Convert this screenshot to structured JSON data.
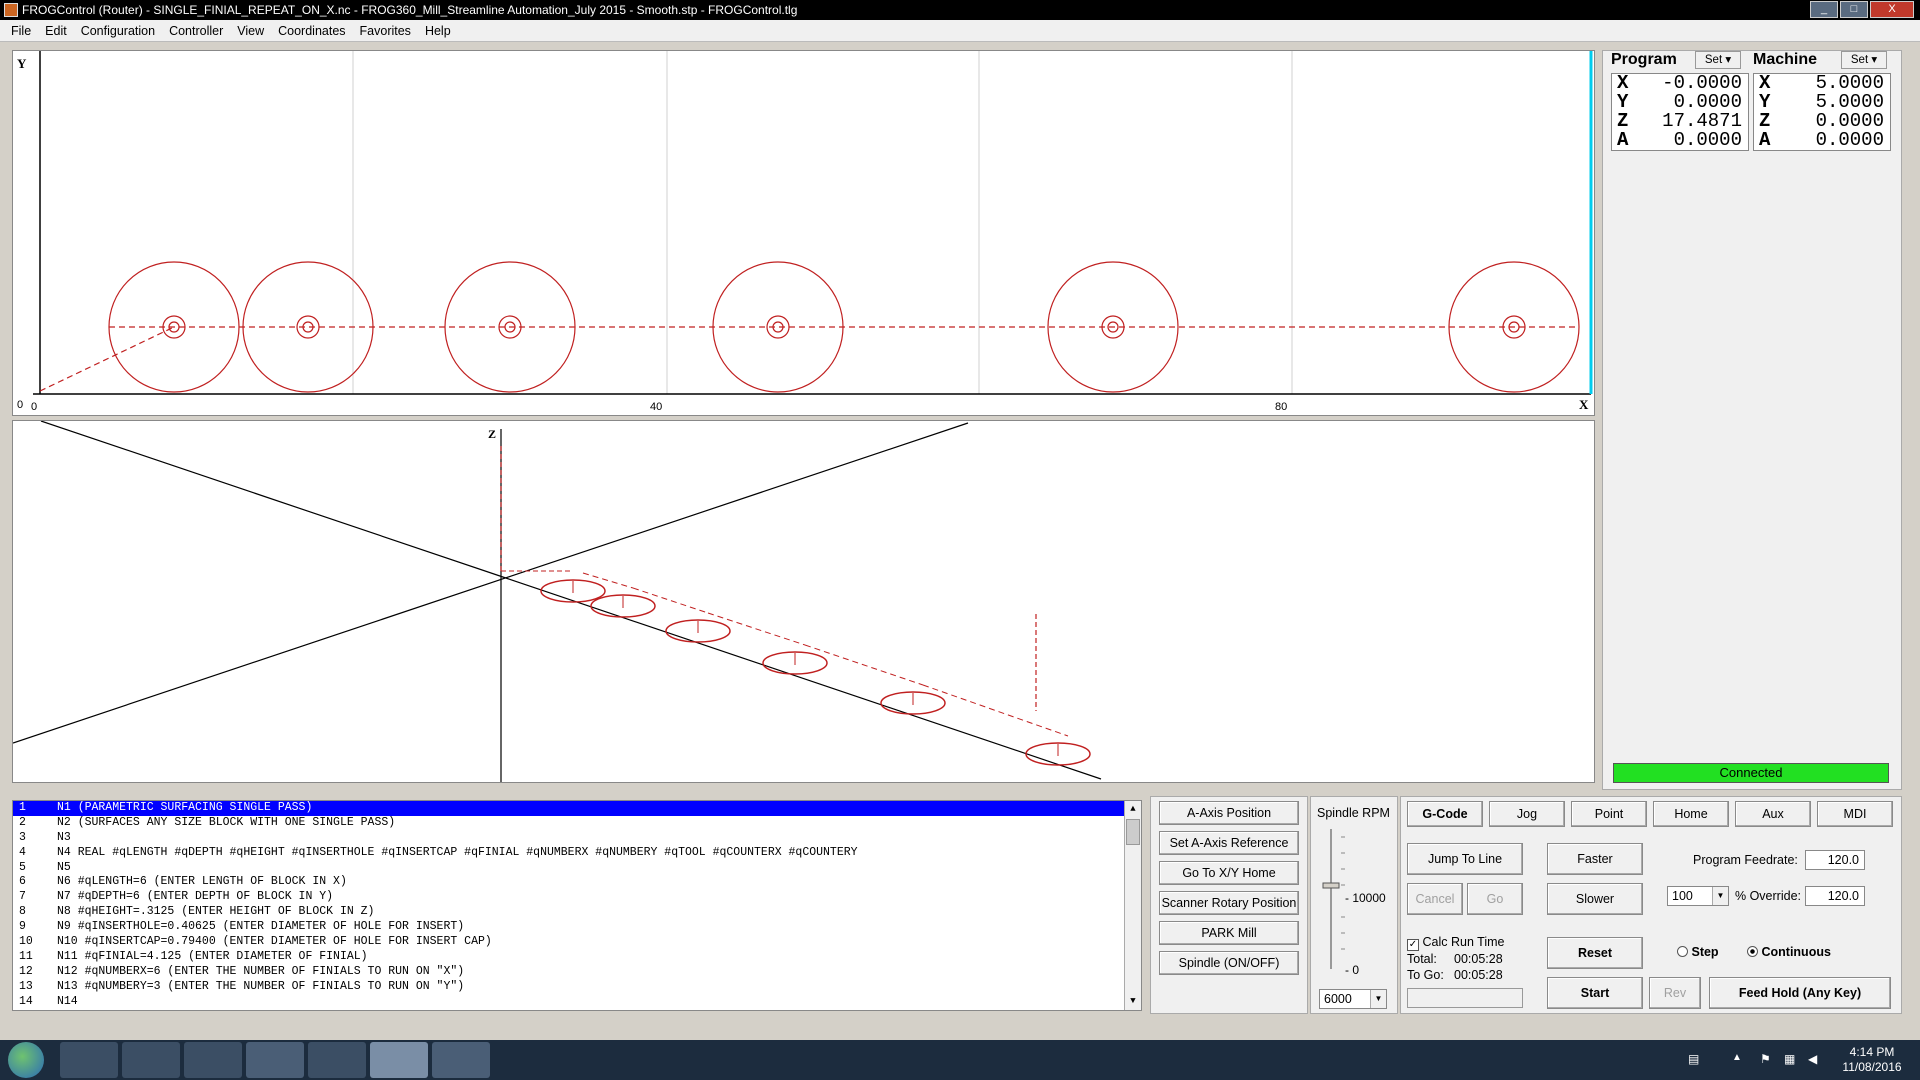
{
  "window": {
    "title": "FROGControl (Router) - SINGLE_FINIAL_REPEAT_ON_X.nc - FROG360_Mill_Streamline Automation_July 2015 - Smooth.stp - FROGControl.tlg",
    "min": "_",
    "max": "□",
    "close": "X"
  },
  "menu": [
    "File",
    "Edit",
    "Configuration",
    "Controller",
    "View",
    "Coordinates",
    "Favorites",
    "Help"
  ],
  "xy_view": {
    "y_axis": "Y",
    "x_axis": "X",
    "origin_y": "0",
    "origin_x": "0",
    "tick_40": "40",
    "tick_80": "80"
  },
  "z_view": {
    "z_axis": "Z"
  },
  "gcode": {
    "lines": [
      {
        "num": "1",
        "text": "N1 (PARAMETRIC SURFACING SINGLE PASS)"
      },
      {
        "num": "2",
        "text": "N2 (SURFACES ANY SIZE BLOCK WITH ONE SINGLE PASS)"
      },
      {
        "num": "3",
        "text": "N3"
      },
      {
        "num": "4",
        "text": "N4 REAL #qLENGTH #qDEPTH #qHEIGHT #qINSERTHOLE #qINSERTCAP #qFINIAL #qNUMBERX #qNUMBERY #qTOOL #qCOUNTERX #qCOUNTERY"
      },
      {
        "num": "5",
        "text": "N5"
      },
      {
        "num": "6",
        "text": "N6 #qLENGTH=6 (ENTER LENGTH OF BLOCK IN X)"
      },
      {
        "num": "7",
        "text": "N7 #qDEPTH=6 (ENTER DEPTH OF BLOCK IN Y)"
      },
      {
        "num": "8",
        "text": "N8 #qHEIGHT=.3125 (ENTER HEIGHT OF BLOCK IN Z)"
      },
      {
        "num": "9",
        "text": "N9 #qINSERTHOLE=0.40625 (ENTER DIAMETER OF HOLE FOR INSERT)"
      },
      {
        "num": "10",
        "text": "N10 #qINSERTCAP=0.79400 (ENTER DIAMETER OF HOLE FOR INSERT CAP)"
      },
      {
        "num": "11",
        "text": "N11 #qFINIAL=4.125 (ENTER DIAMETER OF FINIAL)"
      },
      {
        "num": "12",
        "text": "N12 #qNUMBERX=6 (ENTER THE NUMBER OF FINIALS TO RUN ON \"X\")"
      },
      {
        "num": "13",
        "text": "N13 #qNUMBERY=3 (ENTER THE NUMBER OF FINIALS TO RUN ON \"Y\")"
      },
      {
        "num": "14",
        "text": "N14"
      }
    ]
  },
  "position": {
    "program_label": "Program",
    "machine_label": "Machine",
    "set_label": "Set",
    "program": [
      {
        "axis": "X",
        "value": "-0.0000"
      },
      {
        "axis": "Y",
        "value": "0.0000"
      },
      {
        "axis": "Z",
        "value": "17.4871"
      },
      {
        "axis": "A",
        "value": "0.0000"
      }
    ],
    "machine": [
      {
        "axis": "X",
        "value": "5.0000"
      },
      {
        "axis": "Y",
        "value": "5.0000"
      },
      {
        "axis": "Z",
        "value": "0.0000"
      },
      {
        "axis": "A",
        "value": "0.0000"
      }
    ],
    "status": "Connected",
    "status_color": "#22e022"
  },
  "aux_buttons": [
    "A-Axis Position",
    "Set A-Axis Reference",
    "Go To X/Y Home",
    "Scanner Rotary Position",
    "PARK Mill",
    "Spindle (ON/OFF)"
  ],
  "spindle": {
    "label": "Spindle RPM",
    "tick_high": "- 10000",
    "tick_low": "- 0",
    "rpm": "6000",
    "level": 0.6
  },
  "tabs": [
    "G-Code",
    "Jog",
    "Point",
    "Home",
    "Aux",
    "MDI"
  ],
  "gcode_controls": {
    "jump_to_line": "Jump To Line",
    "cancel": "Cancel",
    "go": "Go",
    "faster": "Faster",
    "slower": "Slower",
    "program_feedrate_label": "Program Feedrate:",
    "program_feedrate": "120.0",
    "override_select": "100",
    "override_label": "% Override:",
    "override_value": "120.0",
    "calc_run_time": "Calc Run Time",
    "total_label": "Total:",
    "total": "00:05:28",
    "togo_label": "To Go:",
    "togo": "00:05:28",
    "reset": "Reset",
    "step": "Step",
    "continuous": "Continuous",
    "start": "Start",
    "rev": "Rev",
    "feed_hold": "Feed Hold (Any Key)"
  },
  "taskbar": {
    "time": "4:14 PM",
    "date": "11/08/2016"
  }
}
